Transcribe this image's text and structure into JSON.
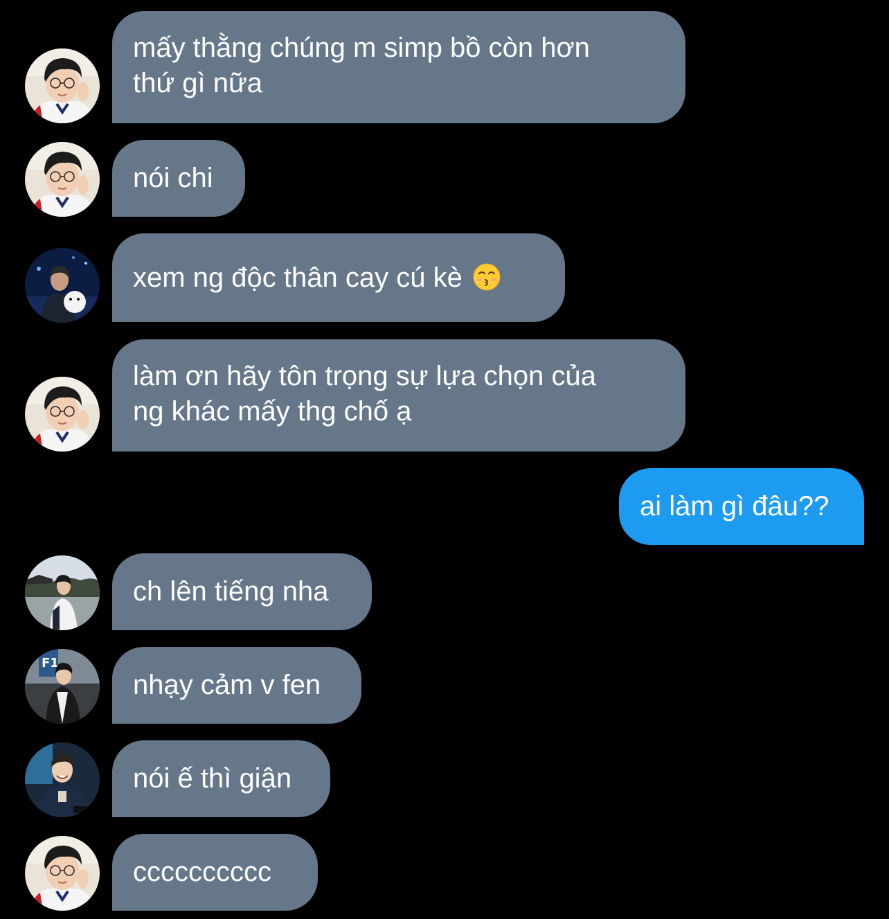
{
  "colors": {
    "background": "#000000",
    "incoming_bubble": "#66778a",
    "outgoing_bubble": "#1d9bf0",
    "text": "#ffffff"
  },
  "messages": [
    {
      "direction": "incoming",
      "avatar": "avatar-glasses-boy",
      "lines": [
        "mấy thằng chúng m simp bồ còn hơn",
        "thứ gì nữa"
      ]
    },
    {
      "direction": "incoming",
      "avatar": "avatar-glasses-boy",
      "lines": [
        "nói chi"
      ]
    },
    {
      "direction": "incoming",
      "avatar": "avatar-blue-night",
      "lines": [
        "xem ng độc thân cay cú kè"
      ],
      "emoji": "kissing-face-emoji"
    },
    {
      "direction": "incoming",
      "avatar": "avatar-glasses-boy",
      "lines": [
        "làm ơn hãy tôn trọng sự lựa chọn của",
        "ng khác mấy thg chố ạ"
      ]
    },
    {
      "direction": "outgoing",
      "lines": [
        "ai làm gì đâu??"
      ]
    },
    {
      "direction": "incoming",
      "avatar": "avatar-outdoor-boy",
      "lines": [
        "ch lên tiếng nha"
      ]
    },
    {
      "direction": "incoming",
      "avatar": "avatar-f1-boy",
      "lines": [
        "nhạy cảm v fen"
      ]
    },
    {
      "direction": "incoming",
      "avatar": "avatar-smiling-boy",
      "lines": [
        "nói ế thì giận"
      ]
    },
    {
      "direction": "incoming",
      "avatar": "avatar-glasses-boy",
      "lines": [
        "cccccccccc"
      ]
    }
  ]
}
